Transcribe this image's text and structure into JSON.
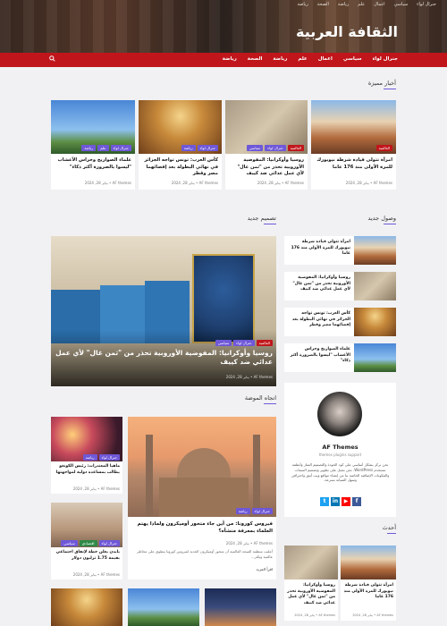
{
  "header": {
    "top_links": [
      "جنرال لواء",
      "سياسي",
      "اعمال",
      "علم",
      "رياضة",
      "الصحة",
      "رياضة"
    ],
    "site_title": "الثقافة العربية",
    "nav": [
      "جنرال لواء",
      "سياسي",
      "اعمال",
      "علم",
      "رياضة",
      "الصحة",
      "رياضة"
    ]
  },
  "featured": {
    "title": "أخبار مميزة",
    "cards": [
      {
        "title": "امرأة تتولى قيادة شرطة نيويورك للمرة الأولى منذ 176 عاما",
        "badges": [
          "العالمية"
        ],
        "meta": "AF themes  •  يناير 28, 2024"
      },
      {
        "title": "روسيا وأوكرانيا: المفوضية الأوروبية تحذر من \"ثمن غال\" لأي عمل عدائي ضد كييف",
        "badges": [
          "سياسي",
          "جنرال لواء",
          "العالمية"
        ],
        "meta": "AF themes  •  يناير 28, 2024"
      },
      {
        "title": "كأس العرب: تونس تواجه الجزائر في نهائي البطولة بعد إقصائهما مصر وقطر",
        "badges": [
          "رياضة",
          "جنرال لواء"
        ],
        "meta": "AF themes  •  يناير 28, 2024"
      },
      {
        "title": "علماء الصواريخ وحراس الأعشاب \"ليسوا بالضرورة أكثر ذكاء\"",
        "badges": [
          "علم",
          "جنرال لواء",
          "رياضة"
        ],
        "meta": "AF themes  •  يناير 28, 2024"
      }
    ]
  },
  "recent": {
    "title": "وصول جديد",
    "items": [
      {
        "title": "امرأة تتولى قيادة شرطة نيويورك للمرة الأولى منذ 176 عاما"
      },
      {
        "title": "روسيا وأوكرانيا: المفوضية الأوروبية تحذر من \"ثمن غال\" لأي عمل عدائي ضد كييف"
      },
      {
        "title": "كأس العرب: تونس تواجه الجزائر في نهائي البطولة بعد إقصائهما مصر وقطر"
      },
      {
        "title": "علماء الصواريخ وحراس الأعشاب \"ليسوا بالضرورة أكثر ذكاء\""
      }
    ]
  },
  "design": {
    "title": "تصميم جديد",
    "hero": {
      "title": "روسيا وأوكرانيا: المفوضية الأوروبية تحذر من \"ثمن غال\" لأي عمل عدائي ضد كييف",
      "badges": [
        "سياسي",
        "جنرال لواء",
        "العالمية"
      ],
      "meta": "AF themes  •  يناير 28, 2024"
    }
  },
  "trend": {
    "title": "اتجاه الموضة",
    "small": [
      {
        "title": "ماهيا المعتدرات: رئيس الكونغو يطالب بمساعدة دولية لمواجهتها",
        "badges": [
          "رياضة",
          "جنرال لواء"
        ],
        "meta": "AF themes  •  يناير 28, 2024"
      },
      {
        "title": "يايدن يعلن خطة لإنفاق اجتماعي بقيمة 1.75 ترليون دولار",
        "badges": [
          "سياسي",
          "اقتصادي",
          "جنرال لواء"
        ],
        "meta": "AF themes  •  يناير 28, 2024"
      }
    ],
    "big": {
      "title": "فيروس كورونا: من أين جاء متحور أوميكرون ولماذا يهتم العلماء بمعرفة منشأه؟",
      "excerpt": "أعلنت منظمة الصحة العالمية أن متحور أوميكرون الجديد لفيروس كورونا ينطوي على مخاطر عالمية ويكثر…",
      "read_more": "اقرأ المزيد",
      "badges": [
        "رياضة",
        "جنرال لواء"
      ],
      "meta": "AF themes  •  يناير 28, 2024"
    }
  },
  "author": {
    "name": "AF Themes",
    "sub": "themes plugins support",
    "bio": "نحن نركز بشكل أساسي على كود الجودة والتصميم المتاز وأنظمة تستخدم WordPress. نحن نعمل على تطوير وتصميم السمات والمكونات الإضافية الخاصة بنا من إنشاء مواقع ويب أنيق واحترافي وسهل الصيانة بسرعة.",
    "socials": [
      "f",
      "in",
      "▶",
      "t"
    ]
  },
  "latest": {
    "title": "أحدث",
    "cards": [
      {
        "title": "امرأة تتولى قيادة شرطة نيويورك للمرة الأولى منذ 176 عاما",
        "meta": "AF themes  •  يناير 28, 2024"
      },
      {
        "title": "روسيا وأوكرانيا: المفوضية الأوروبية تحذر من \"ثمن غال\" لأي عمل عدائي ضد كييف",
        "meta": "AF themes  •  يناير 28, 2024"
      }
    ]
  },
  "colors": {
    "nav": "#c0161b",
    "accent": "#6f58d8",
    "green": "#2f8a47"
  }
}
